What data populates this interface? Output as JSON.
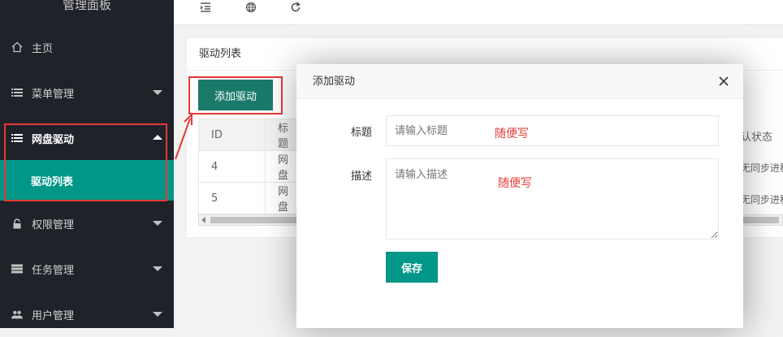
{
  "sidebar": {
    "brand": "管理面板",
    "items": [
      {
        "label": "主页",
        "icon": "home-icon"
      },
      {
        "label": "菜单管理",
        "icon": "list-icon"
      },
      {
        "label": "网盘驱动",
        "icon": "list-icon"
      },
      {
        "label": "权限管理",
        "icon": "lock-icon"
      },
      {
        "label": "任务管理",
        "icon": "tasks-icon"
      },
      {
        "label": "用户管理",
        "icon": "users-icon"
      }
    ],
    "sub_item": "驱动列表"
  },
  "topbar": {
    "icons": [
      "indent-icon",
      "globe-icon",
      "refresh-icon"
    ]
  },
  "card": {
    "title": "驱动列表",
    "add_button": "添加驱动",
    "table": {
      "headers": [
        "ID",
        "标题"
      ],
      "rows": [
        {
          "id": "4",
          "title": "网盘"
        },
        {
          "id": "5",
          "title": "网盘"
        }
      ],
      "right_header": "认状态",
      "right_cells": [
        "无同步进程",
        "无同步进程"
      ]
    }
  },
  "dialog": {
    "title": "添加驱动",
    "title_label": "标题",
    "title_placeholder": "请输入标题",
    "desc_label": "描述",
    "desc_placeholder": "请输入描述",
    "note_title": "随便写",
    "note_desc": "随便写",
    "save_button": "保存"
  },
  "colors": {
    "sidebar_bg": "#20222a",
    "accent": "#009688",
    "annotation_red": "#e53935"
  }
}
